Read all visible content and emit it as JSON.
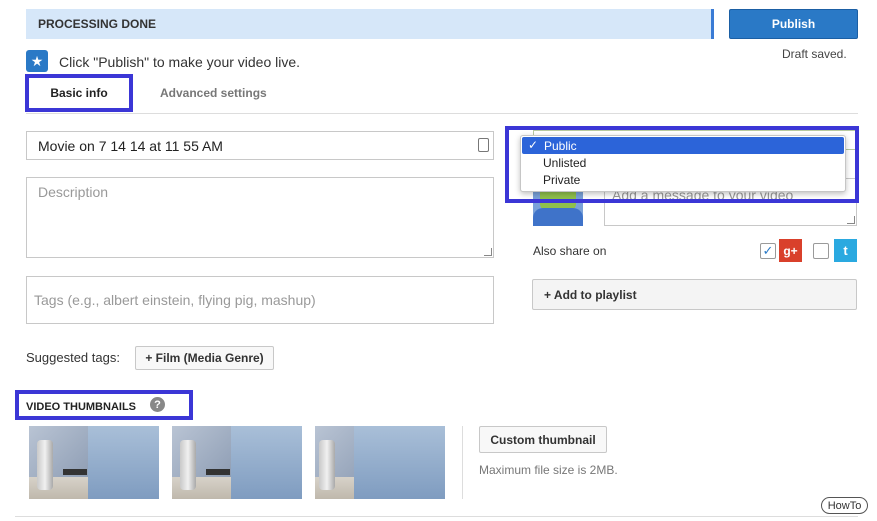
{
  "status": {
    "label": "PROCESSING DONE",
    "draft": "Draft saved."
  },
  "publish": {
    "label": "Publish"
  },
  "instruction": {
    "text": "Click \"Publish\" to make your video live.",
    "icon": "star-icon"
  },
  "tabs": [
    {
      "label": "Basic info",
      "active": true
    },
    {
      "label": "Advanced settings",
      "active": false
    }
  ],
  "form": {
    "title_value": "Movie on 7 14 14 at 11 55 AM",
    "description_placeholder": "Description",
    "tags_placeholder": "Tags (e.g., albert einstein, flying pig, mashup)",
    "suggested_label": "Suggested tags:",
    "suggested_chip": "+ Film (Media Genre)"
  },
  "privacy": {
    "options": [
      "Public",
      "Unlisted",
      "Private"
    ],
    "selected": "Public",
    "check": "✓"
  },
  "share": {
    "message_placeholder": "Add a message to your video",
    "also_share_label": "Also share on",
    "gplus_checked": true,
    "twitter_checked": false,
    "gplus_icon": "google-plus-icon",
    "twitter_icon": "twitter-icon"
  },
  "playlist": {
    "label": "+ Add to playlist"
  },
  "thumbnails": {
    "heading": "VIDEO THUMBNAILS",
    "help": "?",
    "custom_label": "Custom thumbnail",
    "max_size": "Maximum file size is 2MB."
  },
  "watermark": {
    "text": "HowTo"
  },
  "colors": {
    "accent": "#2a79c6",
    "highlight": "#3b36d6",
    "selected_option": "#2c64d9"
  }
}
